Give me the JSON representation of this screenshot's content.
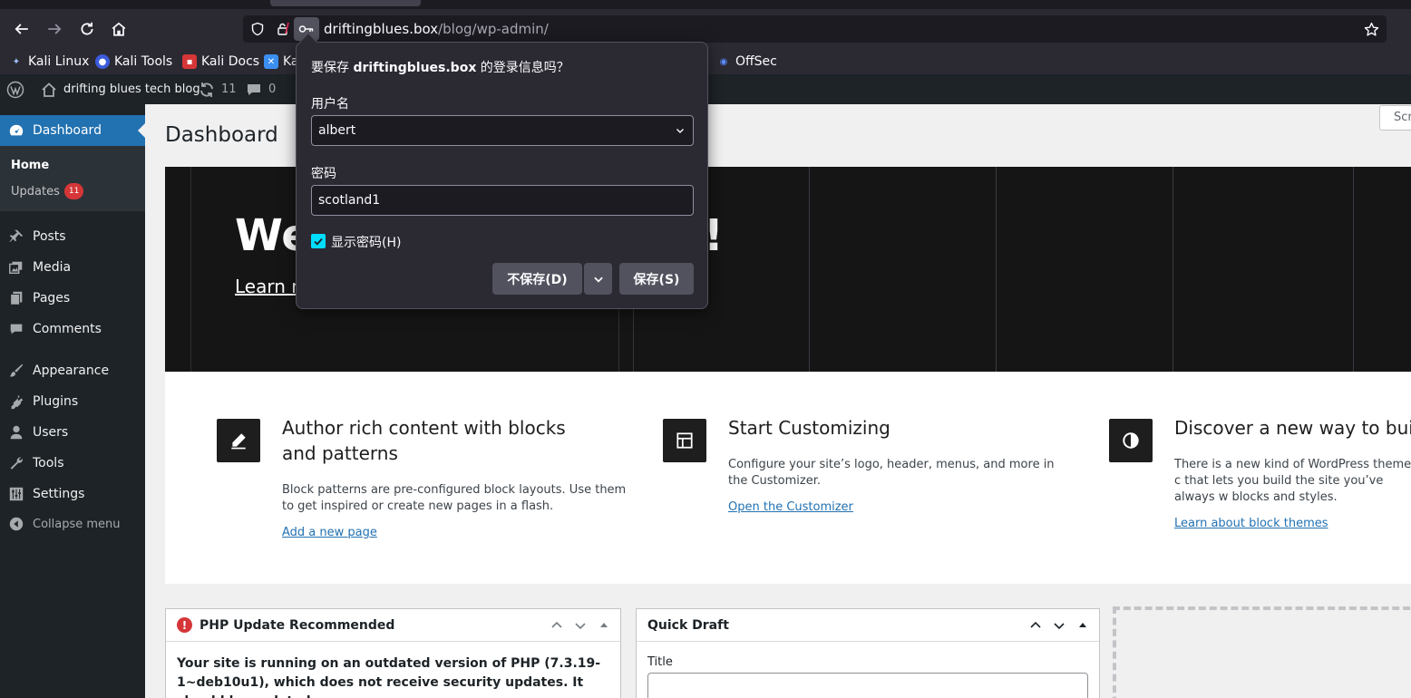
{
  "browser": {
    "url_host": "driftingblues.box",
    "url_path": "/blog/wp-admin/",
    "bookmarks": [
      {
        "label": "Kali Linux"
      },
      {
        "label": "Kali Tools"
      },
      {
        "label": "Kali Docs"
      },
      {
        "label": "Ka"
      },
      {
        "label": "OffSec"
      }
    ]
  },
  "adminbar": {
    "site_name": "drifting blues tech blog",
    "updates_count": "11",
    "comments_count": "0"
  },
  "sidebar": {
    "dashboard": "Dashboard",
    "submenu": {
      "home": "Home",
      "updates": "Updates",
      "updates_badge": "11"
    },
    "items": [
      {
        "label": "Posts"
      },
      {
        "label": "Media"
      },
      {
        "label": "Pages"
      },
      {
        "label": "Comments"
      },
      {
        "label": "Appearance"
      },
      {
        "label": "Plugins"
      },
      {
        "label": "Users"
      },
      {
        "label": "Tools"
      },
      {
        "label": "Settings"
      }
    ],
    "collapse": "Collapse menu"
  },
  "main": {
    "screen_options": "Scr",
    "title": "Dashboard",
    "welcome": {
      "title_visible": "We",
      "title_end": "!",
      "learn_more": "Learn m",
      "columns": [
        {
          "heading": "Author rich content with blocks and patterns",
          "text": "Block patterns are pre-configured block layouts. Use them to get inspired or create new pages in a flash.",
          "link": "Add a new page"
        },
        {
          "heading": "Start Customizing",
          "text": "Configure your site’s logo, header, menus, and more in the Customizer.",
          "link": "Open the Customizer"
        },
        {
          "heading": "Discover a new way to build y",
          "text": "There is a new kind of WordPress theme, c that lets you build the site you’ve always w blocks and styles.",
          "link": "Learn about block themes"
        }
      ]
    },
    "php_box": {
      "title": "PHP Update Recommended",
      "body": "Your site is running on an outdated version of PHP (7.3.19-1~deb10u1), which does not receive security updates. It should be updated."
    },
    "draft_box": {
      "title": "Quick Draft",
      "title_label": "Title"
    }
  },
  "login_popup": {
    "title_prefix": "要保存 ",
    "title_host": "driftingblues.box",
    "title_suffix": " 的登录信息吗？",
    "username_label": "用户名",
    "username_value": "albert",
    "password_label": "密码",
    "password_value": "scotland1",
    "show_password": "显示密码(H)",
    "show_password_checked": true,
    "dont_save": "不保存(D)",
    "save": "保存(S)",
    "accent_color": "#00ddff"
  }
}
